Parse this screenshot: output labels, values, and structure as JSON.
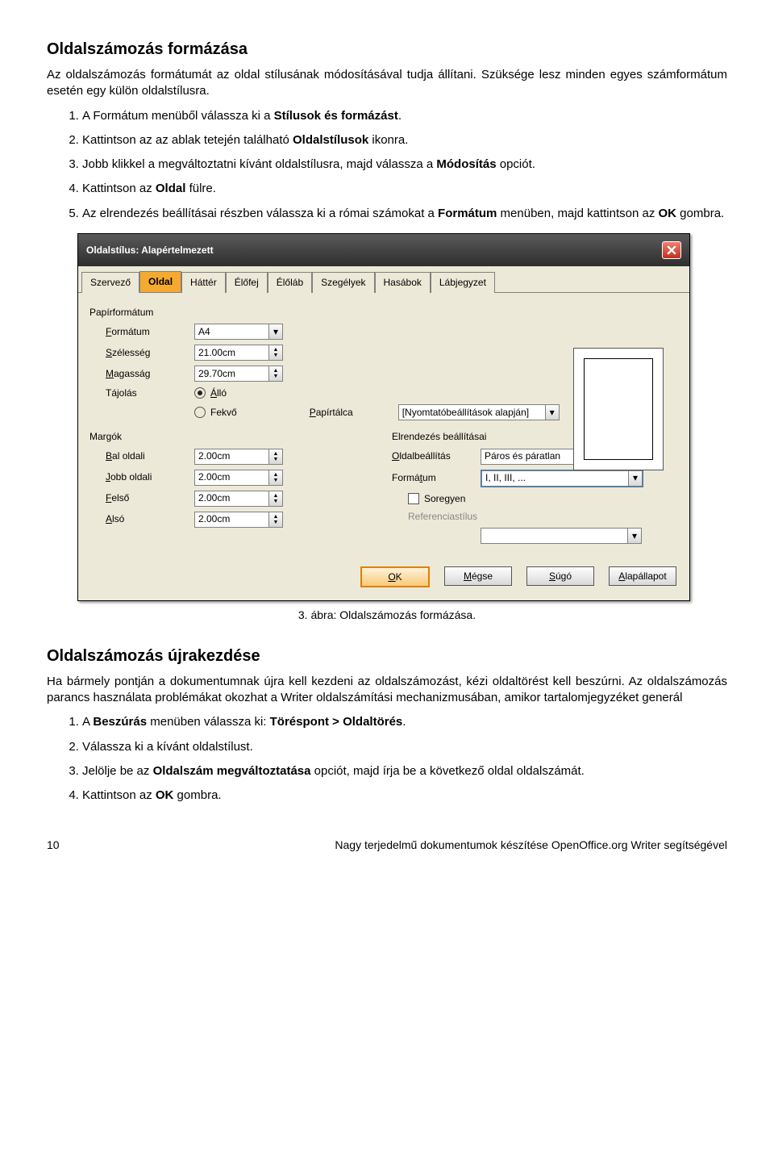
{
  "doc": {
    "h1": "Oldalszámozás formázása",
    "intro": "Az oldalszámozás formátumát az oldal stílusának módosításával tudja állítani. Szüksége lesz minden egyes számformátum esetén egy külön oldalstílusra.",
    "steps1": [
      "A Formátum menüből válassza ki a Stílusok és formázást.",
      "Kattintson az az ablak tetején található Oldalstílusok ikonra.",
      "Jobb klikkel a megváltoztatni kívánt oldalstílusra, majd válassza a Módosítás opciót.",
      "Kattintson az Oldal fülre.",
      "Az elrendezés beállításai részben válassza ki a római számokat a Formátum menüben, majd kattintson az OK gombra."
    ],
    "bold1": {
      "a": "Stílusok és formázást",
      "b": "Oldalstílusok",
      "c": "Módosítás",
      "d": "Oldal",
      "e": "Formátum",
      "f": "OK"
    },
    "caption": "3. ábra: Oldalszámozás formázása.",
    "h2": "Oldalszámozás újrakezdése",
    "para2": "Ha bármely pontján a dokumentumnak újra kell kezdeni az oldalszámozást, kézi oldaltörést kell beszúrni. Az oldalszámozás parancs használata problémákat okozhat a Writer oldalszámítási mechanizmusában, amikor tartalomjegyzéket generál",
    "steps2": [
      "A Beszúrás menüben válassza ki: Töréspont > Oldaltörés.",
      "Válassza ki a kívánt oldalstílust.",
      "Jelölje be az Oldalszám megváltoztatása opciót, majd írja be a következő oldal oldalszámát.",
      "Kattintson az OK gombra."
    ],
    "bold2": {
      "a": "Beszúrás",
      "b": "Töréspont > Oldaltörés",
      "c": "Oldalszám megváltoztatása",
      "d": "OK"
    },
    "footer_left": "10",
    "footer_right": "Nagy terjedelmű dokumentumok készítése OpenOffice.org Writer segítségével"
  },
  "dlg": {
    "title": "Oldalstílus: Alapértelmezett",
    "tabs": [
      "Szervező",
      "Oldal",
      "Háttér",
      "Élőfej",
      "Élőláb",
      "Szegélyek",
      "Hasábok",
      "Lábjegyzet"
    ],
    "active_tab": 1,
    "group_paper": "Papírformátum",
    "lbl_format": "Formátum",
    "val_format": "A4",
    "lbl_width": "Szélesség",
    "val_width": "21.00cm",
    "lbl_height": "Magasság",
    "val_height": "29.70cm",
    "lbl_orient": "Tájolás",
    "opt_portrait": "Álló",
    "opt_landscape": "Fekvő",
    "lbl_tray": "Papírtálca",
    "val_tray": "[Nyomtatóbeállítások alapján]",
    "group_margins": "Margók",
    "lbl_left": "Bal oldali",
    "lbl_right": "Jobb oldali",
    "lbl_top": "Felső",
    "lbl_bottom": "Alsó",
    "val_margin": "2.00cm",
    "group_layout": "Elrendezés beállításai",
    "lbl_pagelayout": "Oldalbeállítás",
    "val_pagelayout": "Páros és páratlan",
    "lbl_numfmt": "Formátum",
    "val_numfmt": "I, II, III, ...",
    "lbl_register": "Soregyen",
    "lbl_refstyle": "Referenciastílus",
    "btn_ok": "OK",
    "btn_cancel": "Mégse",
    "btn_help": "Súgó",
    "btn_reset": "Alapállapot"
  }
}
